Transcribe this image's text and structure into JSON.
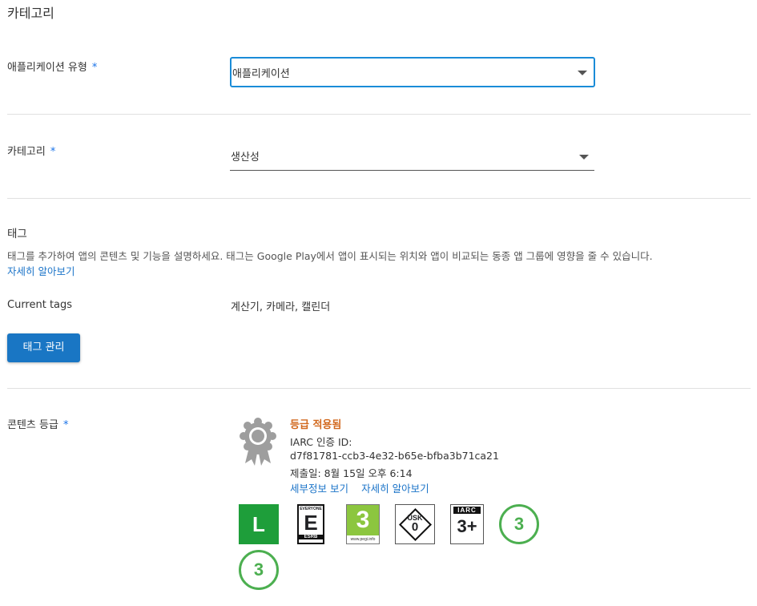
{
  "header": {
    "title": "카테고리"
  },
  "app_type": {
    "label": "애플리케이션 유형",
    "required": "*",
    "value": "애플리케이션"
  },
  "category": {
    "label": "카테고리",
    "required": "*",
    "value": "생산성"
  },
  "tags": {
    "title": "태그",
    "description": "태그를 추가하여 앱의 콘텐츠 및 기능을 설명하세요. 태그는 Google Play에서 앱이 표시되는 위치와 앱이 비교되는 동종 앱 그룹에 영향을 줄 수 있습니다.",
    "learn_more": "자세히 알아보기",
    "current_label": "Current tags",
    "current_value": "계산기, 카메라, 캘린더",
    "manage_button": "태그 관리"
  },
  "content_rating": {
    "label": "콘텐츠 등급",
    "required": "*",
    "status": "등급 적용됨",
    "iarc_label": "IARC 인증 ID:",
    "iarc_id": "d7f81781-ccb3-4e32-b65e-bfba3b71ca21",
    "submitted": "제출일: 8월 15일 오후 6:14",
    "details_link": "세부정보 보기",
    "learn_more_link": "자세히 알아보기",
    "badges": {
      "l_text": "L",
      "esrb_top": "EVERYONE",
      "esrb_letter": "E",
      "esrb_bottom": "ESRB",
      "pegi_num": "3",
      "pegi_site": "www.pegi.info",
      "usk_text": "USK",
      "usk_num": "0",
      "iarc_text": "IARC",
      "iarc_num": "3+",
      "circle1": "3",
      "circle2": "3"
    },
    "colors": {
      "status": "#d2691e",
      "l_green": "#1e9e3a",
      "pegi_green": "#8cc63f",
      "circle_green": "#4caf50"
    }
  }
}
